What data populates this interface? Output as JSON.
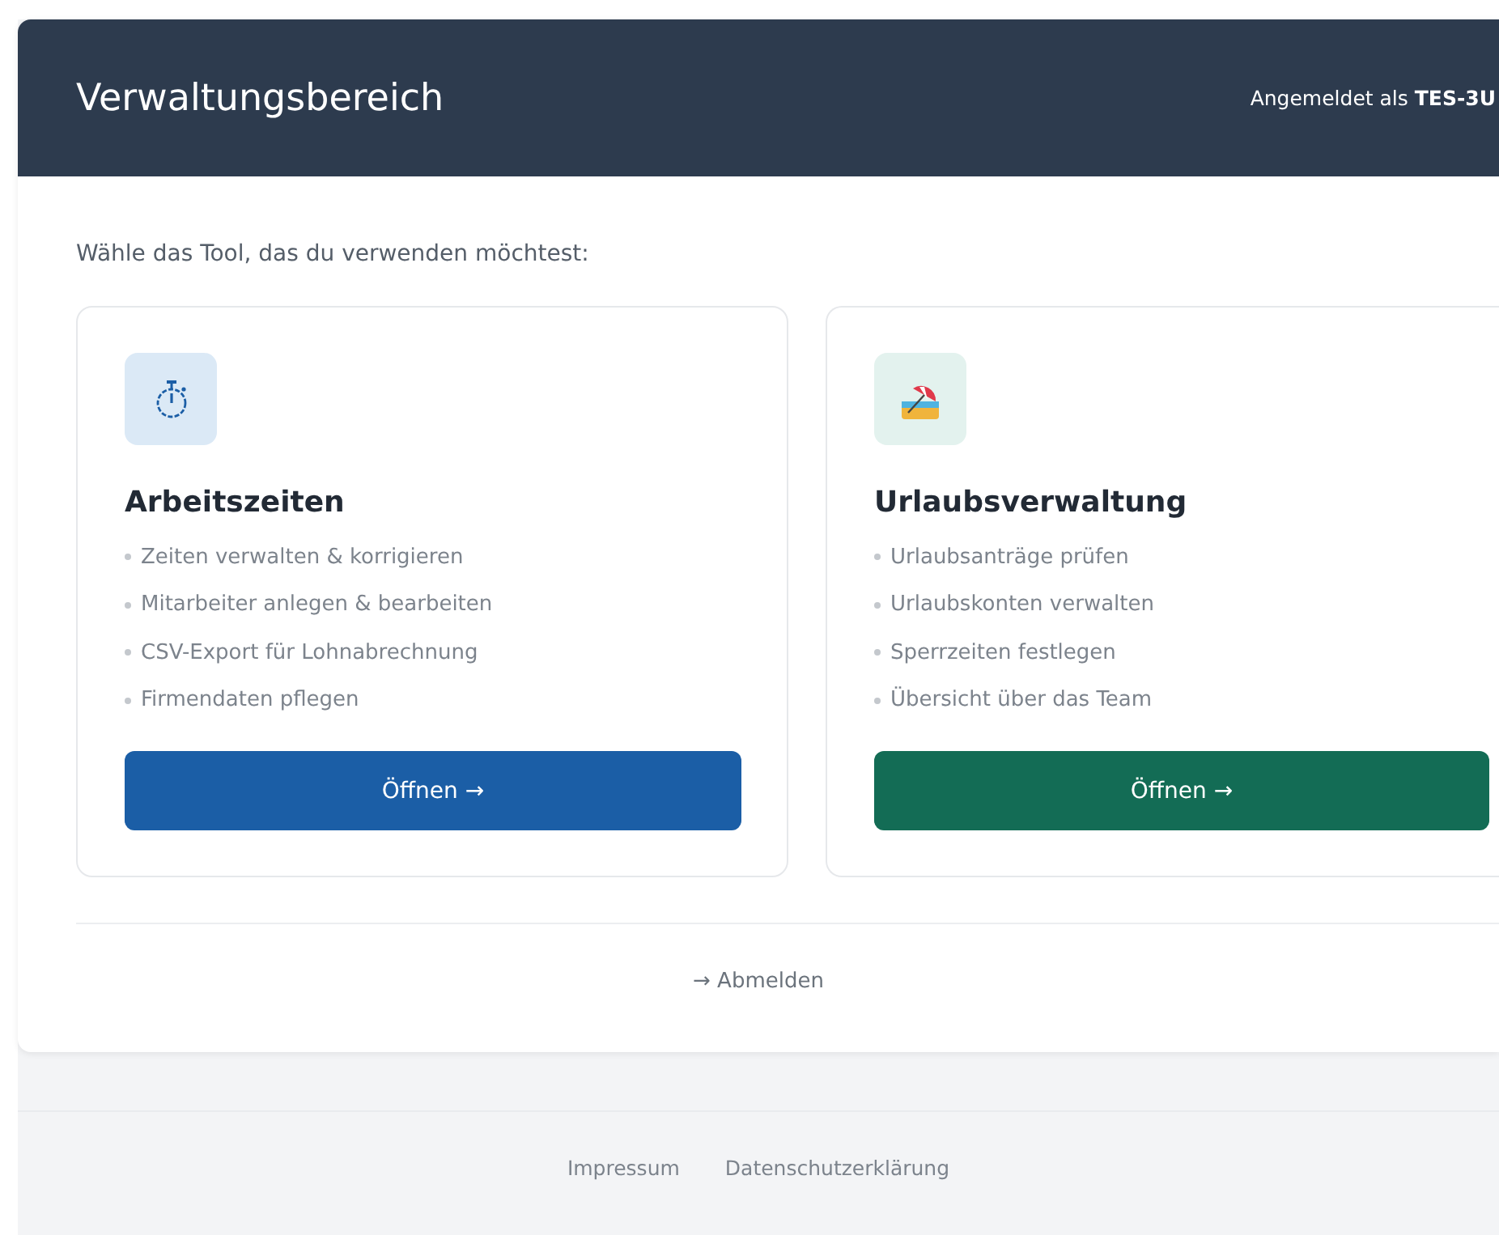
{
  "header": {
    "title": "Verwaltungsbereich",
    "user_label": "Angemeldet als **TES-3U**"
  },
  "intro": "Wähle das Tool, das du verwenden möchtest:",
  "tools": [
    {
      "kind": "stopwatch",
      "title": "Arbeitszeiten",
      "features": [
        "Zeiten verwalten & korrigieren",
        "Mitarbeiter anlegen & bearbeiten",
        "CSV-Export für Lohnabrechnung",
        "Firmendaten pflegen"
      ],
      "button": "Öffnen →",
      "color": "#1b5ea6"
    },
    {
      "kind": "beach",
      "title": "Urlaubsverwaltung",
      "features": [
        "Urlaubsanträge prüfen",
        "Urlaubskonten verwalten",
        "Sperrzeiten festlegen",
        "Übersicht über das Team"
      ],
      "button": "Öffnen →",
      "color": "#136c55"
    }
  ],
  "logout": "→ Abmelden",
  "footer_links": [
    "Impressum",
    "Datenschutzerklärung"
  ]
}
